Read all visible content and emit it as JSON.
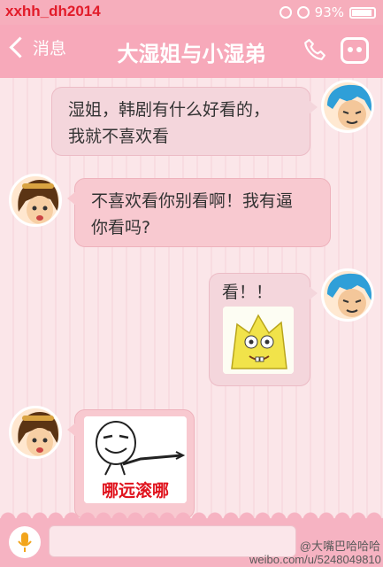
{
  "status_bar": {
    "carrier": "xxhh_dh2014",
    "battery": "93%",
    "battery_level": 0.93,
    "icons": [
      "lock-rotation-icon",
      "alarm-icon",
      "battery-icon"
    ]
  },
  "nav": {
    "back_label": "消息",
    "title": "大湿姐与小湿弟",
    "icons": [
      "chevron-left-icon",
      "phone-icon",
      "menu-icon"
    ]
  },
  "messages": [
    {
      "side": "out",
      "text_lines": [
        "湿姐，韩剧有什么好看的，",
        "我就不喜欢看"
      ]
    },
    {
      "side": "in",
      "text_lines": [
        "不喜欢看你别看啊！我有逼",
        "你看吗?"
      ]
    },
    {
      "side": "out",
      "text": "看！！",
      "sticker": "spongebob-sticker"
    },
    {
      "side": "in",
      "sticker": "rage-face-sticker",
      "sticker_caption": "哪远滚哪"
    }
  ],
  "input_bar": {
    "value": "",
    "icons": [
      "microphone-icon"
    ]
  },
  "watermark": {
    "line1": "@大嘴巴哈哈哈",
    "line2": "weibo.com/u/5248049810"
  },
  "colors": {
    "accent_pink": "#f7a9ba",
    "carrier_red": "#e21c2a",
    "caption_red": "#e0141e"
  }
}
